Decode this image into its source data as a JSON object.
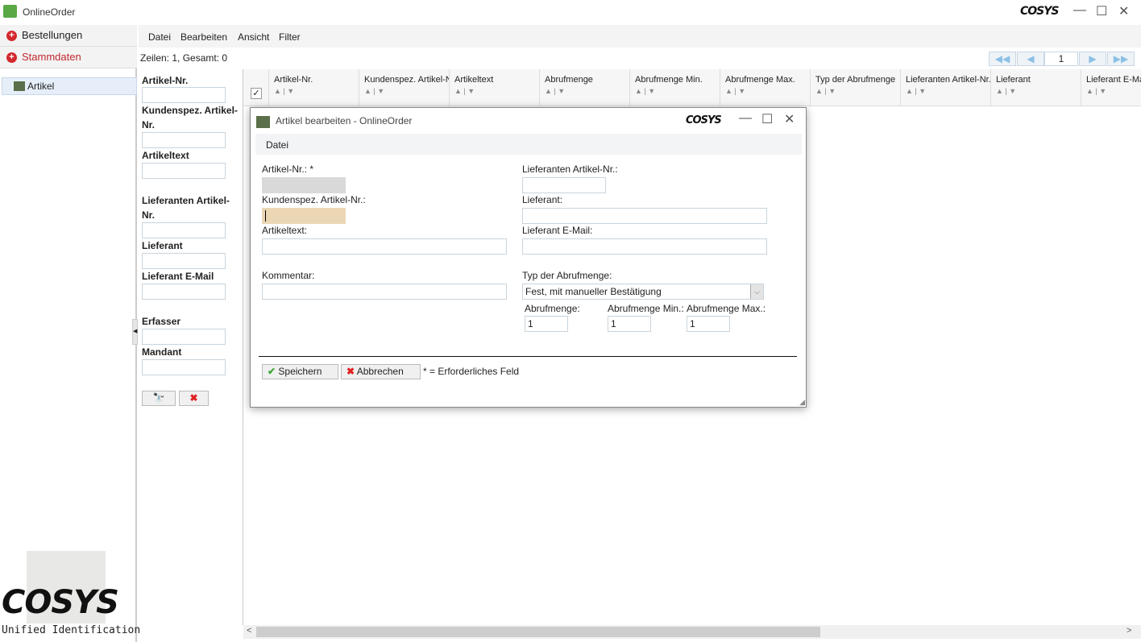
{
  "app": {
    "title": "OnlineOrder",
    "brand": "COSYS",
    "brand_tagline": "Unified Identification"
  },
  "nav": {
    "items": [
      {
        "label": "Bestellungen"
      },
      {
        "label": "Stammdaten"
      }
    ],
    "tree": [
      {
        "label": "Artikel",
        "icon": "artikel-icon"
      }
    ]
  },
  "menu": [
    "Datei",
    "Bearbeiten",
    "Ansicht",
    "Filter"
  ],
  "status": "Zeilen: 1, Gesamt: 0",
  "pager": {
    "page": "1"
  },
  "filter": {
    "fields": [
      {
        "label": "Artikel-Nr.",
        "value": ""
      },
      {
        "label": "Kundenspez. Artikel-Nr.",
        "value": ""
      },
      {
        "label": "Artikeltext",
        "value": ""
      },
      {
        "label": "Lieferanten Artikel-Nr.",
        "value": ""
      },
      {
        "label": "Lieferant",
        "value": ""
      },
      {
        "label": "Lieferant E-Mail",
        "value": ""
      },
      {
        "label": "Erfasser",
        "value": ""
      },
      {
        "label": "Mandant",
        "value": ""
      }
    ]
  },
  "grid": {
    "columns": [
      "Artikel-Nr.",
      "Kundenspez. Artikel-Nr.",
      "Artikeltext",
      "Abrufmenge",
      "Abrufmenge Min.",
      "Abrufmenge Max.",
      "Typ der Abrufmenge",
      "Lieferanten Artikel-Nr.",
      "Lieferant",
      "Lieferant E-Mail"
    ]
  },
  "dialog": {
    "title": "Artikel bearbeiten - OnlineOrder",
    "menu": "Datei",
    "artikel_nr_label": "Artikel-Nr.: *",
    "kundenspez_label": "Kundenspez. Artikel-Nr.:",
    "artikeltext_label": "Artikeltext:",
    "kommentar_label": "Kommentar:",
    "lief_artnr_label": "Lieferanten Artikel-Nr.:",
    "lieferant_label": "Lieferant:",
    "lief_email_label": "Lieferant E-Mail:",
    "typ_label": "Typ der Abrufmenge:",
    "typ_value": "Fest, mit manueller Bestätigung",
    "abruf_label": "Abrufmenge:",
    "abruf_value": "1",
    "abruf_min_label": "Abrufmenge Min.:",
    "abruf_min_value": "1",
    "abruf_max_label": "Abrufmenge Max.:",
    "abruf_max_value": "1",
    "save": "Speichern",
    "cancel": "Abbrechen",
    "required_note": "* = Erforderliches Feld"
  },
  "colors": {
    "accent_red": "#d3282e",
    "readonly_field": "#d9d9d9",
    "focused_field": "#ecd7b5"
  }
}
